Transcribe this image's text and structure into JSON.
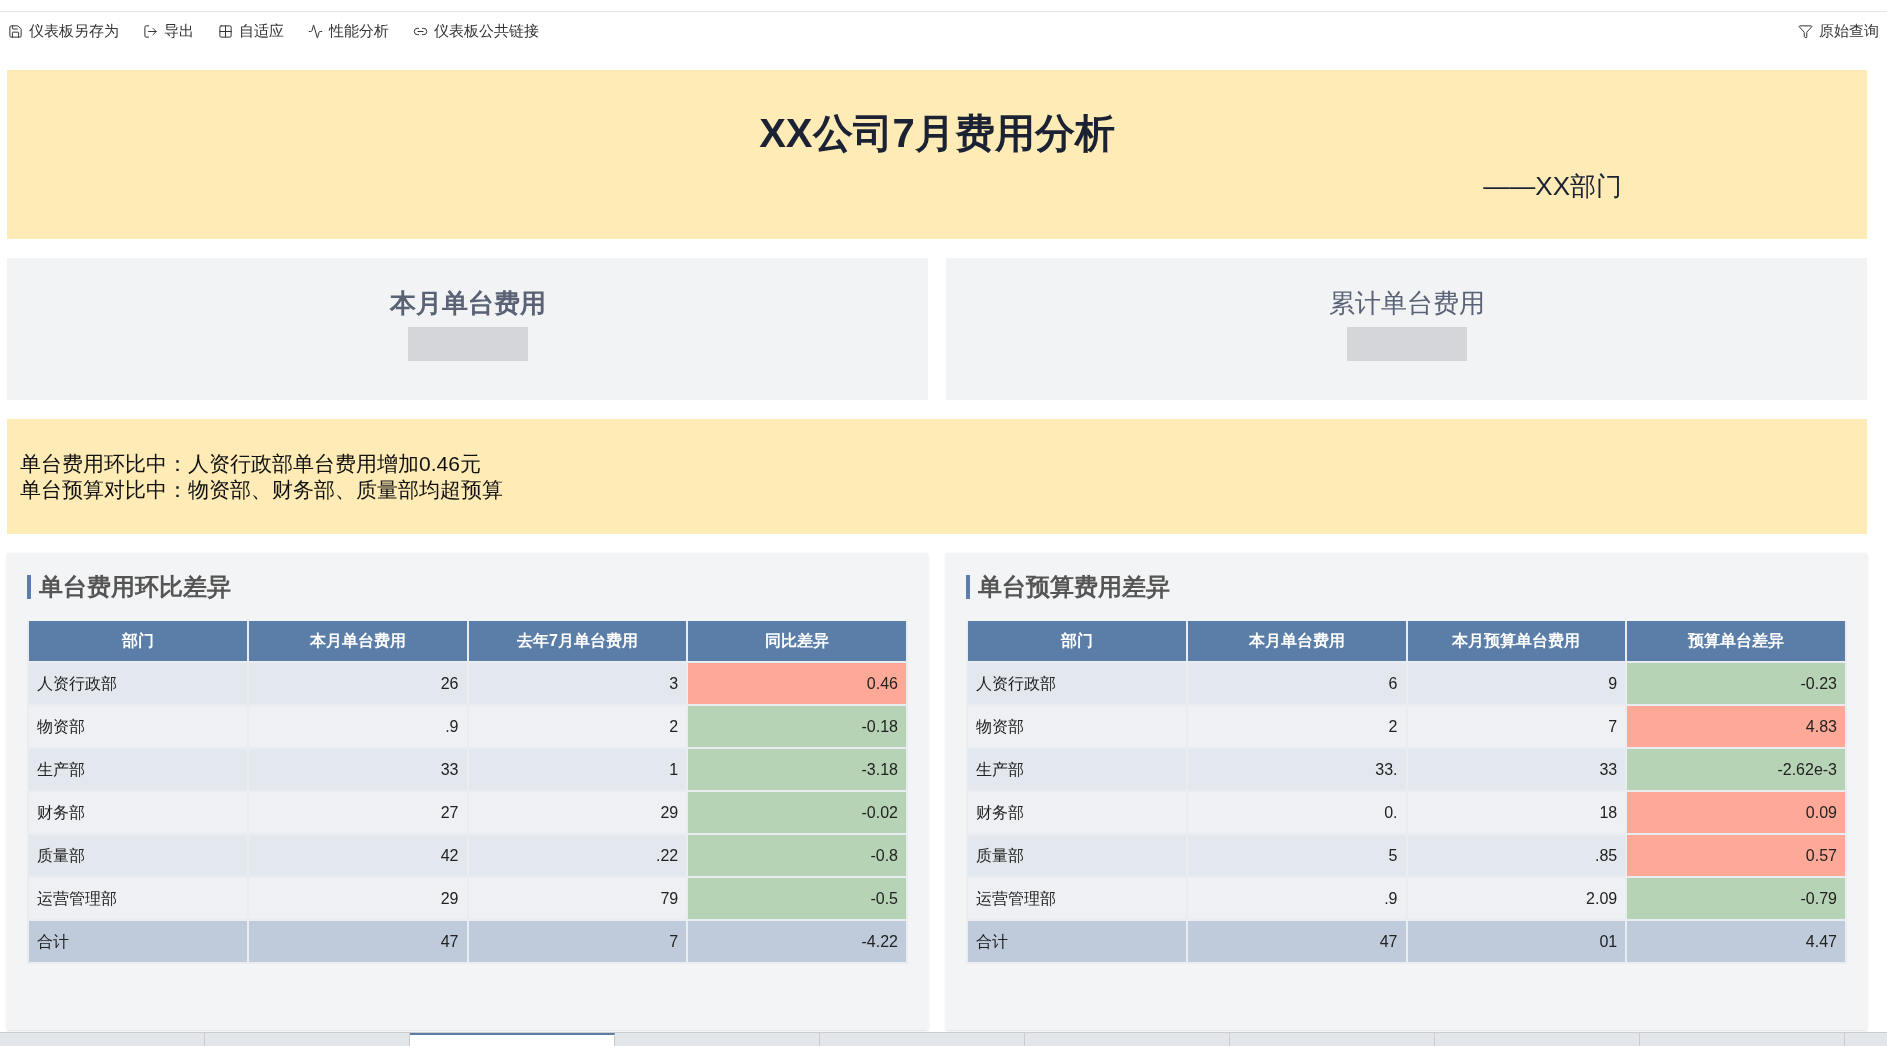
{
  "toolbar": {
    "items": [
      {
        "kind": "save",
        "label": "仪表板另存为"
      },
      {
        "kind": "export",
        "label": "导出"
      },
      {
        "kind": "fit",
        "label": "自适应"
      },
      {
        "kind": "perf",
        "label": "性能分析"
      },
      {
        "kind": "link",
        "label": "仪表板公共链接"
      }
    ],
    "right": {
      "kind": "filter",
      "label": "原始查询"
    }
  },
  "banner": {
    "title": "XX公司7月费用分析",
    "subtitle": "——XX部门"
  },
  "kpis": [
    {
      "label": "本月单台费用",
      "bold": true
    },
    {
      "label": "累计单台费用",
      "bold": false
    }
  ],
  "summary": [
    "单台费用环比中：人资行政部单台费用增加0.46元",
    "单台预算对比中：物资部、财务部、质量部均超预算"
  ],
  "tables": [
    {
      "title": "单台费用环比差异",
      "columns": [
        "部门",
        "本月单台费用",
        "去年7月单台费用",
        "同比差异"
      ],
      "rows": [
        {
          "cells": [
            "人资行政部",
            "26",
            "3",
            "0.46"
          ],
          "color": "#fea998"
        },
        {
          "cells": [
            "物资部",
            ".9",
            "2",
            "-0.18"
          ],
          "color": "#b7d3b5"
        },
        {
          "cells": [
            "生产部",
            "33",
            "1",
            "-3.18"
          ],
          "color": "#b7d3b5"
        },
        {
          "cells": [
            "财务部",
            "27",
            "29",
            "-0.02"
          ],
          "color": "#b7d3b5"
        },
        {
          "cells": [
            "质量部",
            "42",
            ".22",
            "-0.8"
          ],
          "color": "#b7d3b5"
        },
        {
          "cells": [
            "运营管理部",
            "29",
            "79",
            "-0.5"
          ],
          "color": "#b7d3b5"
        }
      ],
      "total": [
        "合计",
        "47",
        "7",
        "-4.22"
      ]
    },
    {
      "title": "单台预算费用差异",
      "columns": [
        "部门",
        "本月单台费用",
        "本月预算单台费用",
        "预算单台差异"
      ],
      "rows": [
        {
          "cells": [
            "人资行政部",
            "6",
            "9",
            "-0.23"
          ],
          "color": "#b7d3b5"
        },
        {
          "cells": [
            "物资部",
            "2",
            "7",
            "4.83"
          ],
          "color": "#fea998"
        },
        {
          "cells": [
            "生产部",
            "33.",
            "33",
            "-2.62e-3"
          ],
          "color": "#b7d3b5"
        },
        {
          "cells": [
            "财务部",
            "0.",
            "18",
            "0.09"
          ],
          "color": "#fea998"
        },
        {
          "cells": [
            "质量部",
            "5",
            ".85",
            "0.57"
          ],
          "color": "#fea998"
        },
        {
          "cells": [
            "运营管理部",
            ".9",
            "2.09",
            "-0.79"
          ],
          "color": "#b7d3b5"
        }
      ],
      "total": [
        "合计",
        "47",
        "01",
        "4.47"
      ]
    }
  ],
  "bottom_tabs": [
    {
      "selected": false
    },
    {
      "selected": false
    },
    {
      "selected": true
    },
    {
      "selected": false
    },
    {
      "selected": false
    },
    {
      "selected": false
    },
    {
      "selected": false
    },
    {
      "selected": false
    },
    {
      "selected": false
    }
  ]
}
